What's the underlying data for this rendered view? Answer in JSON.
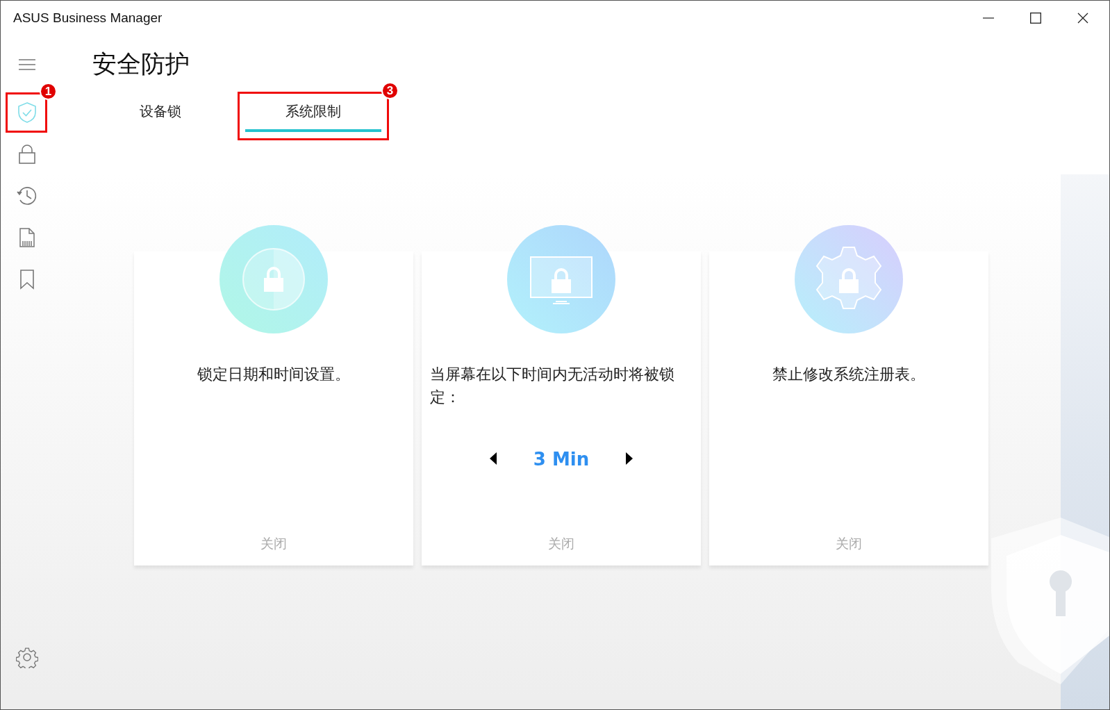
{
  "window": {
    "title": "ASUS Business Manager"
  },
  "sidebar": {
    "items": [
      {
        "kind": "shield",
        "selected": true,
        "callout": "1"
      },
      {
        "kind": "lock",
        "selected": false
      },
      {
        "kind": "history",
        "selected": false
      },
      {
        "kind": "file",
        "selected": false
      },
      {
        "kind": "bookmark",
        "selected": false
      }
    ]
  },
  "page": {
    "title": "安全防护"
  },
  "tabs": [
    {
      "label": "设备锁",
      "selected": false
    },
    {
      "label": "系统限制",
      "selected": true,
      "callout": "3"
    }
  ],
  "cards": [
    {
      "kind": "clock",
      "text": "锁定日期和时间设置。",
      "status": "关闭"
    },
    {
      "kind": "screen",
      "text": "当屏幕在以下时间内无活动时将被锁定：",
      "stepper": {
        "value": "3 Min"
      },
      "status": "关闭"
    },
    {
      "kind": "gear",
      "text": "禁止修改系统注册表。",
      "status": "关闭"
    }
  ]
}
